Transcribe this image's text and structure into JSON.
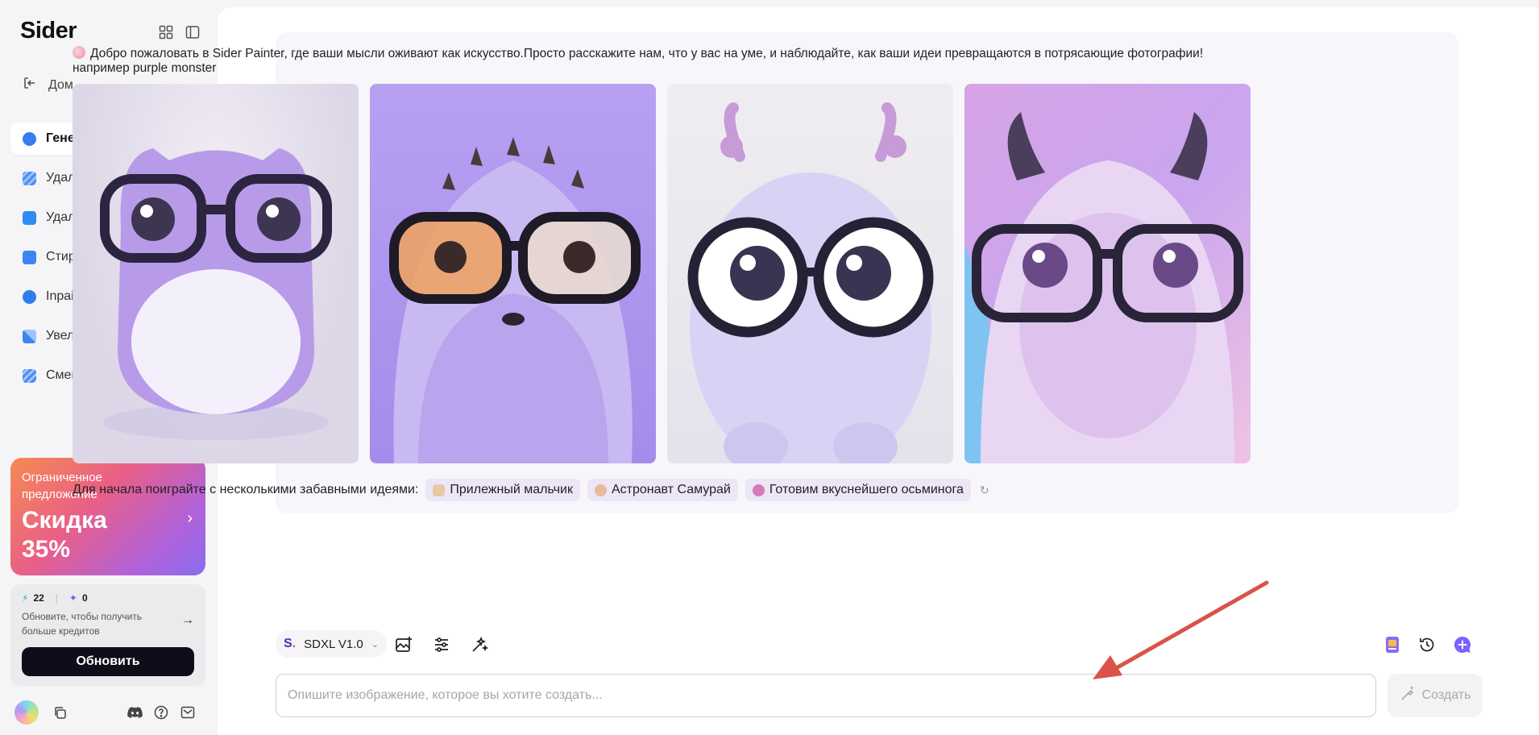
{
  "app": {
    "name": "Sider"
  },
  "sidebar": {
    "home_label": "Дом",
    "items": [
      {
        "label": "Генератор изображе...",
        "icon": "image-generator-icon",
        "color": "#3a7bf0",
        "active": true
      },
      {
        "label": "Удаление фона",
        "icon": "background-remove-icon",
        "color": "#4b8ef5",
        "active": false
      },
      {
        "label": "Удаление текста",
        "icon": "text-remove-icon",
        "color": "#2f8cf0",
        "active": false
      },
      {
        "label": "Стирание Фото",
        "icon": "photo-erase-icon",
        "color": "#3b86f2",
        "active": false
      },
      {
        "label": "Inpaint",
        "icon": "inpaint-icon",
        "color": "#2f7de8",
        "active": false
      },
      {
        "label": "Увеличитель изображ...",
        "icon": "upscale-icon",
        "color": "#3a85f0",
        "active": false
      },
      {
        "label": "Сменщик фона",
        "icon": "background-change-icon",
        "color": "#4a8cf0",
        "active": false
      }
    ],
    "promo": {
      "line1": "Ограниченное предложение",
      "title": "Скидка 35%"
    },
    "credits": {
      "fast": "22",
      "advanced": "0",
      "note": "Обновите, чтобы получить больше кредитов",
      "upgrade_label": "Обновить"
    }
  },
  "main": {
    "welcome": "Добро пожаловать в Sider Painter, где ваши мысли оживают как искусство.Просто расскажите нам, что у вас на уме, и наблюдайте, как ваши идеи превращаются в потрясающие фотографии!",
    "example": "например purple monster",
    "ideas_label": "Для начала поиграйте с несколькими забавными идеями:",
    "ideas": [
      {
        "label": "Прилежный мальчик",
        "color": "#e9c9a3"
      },
      {
        "label": "Астронавт Самурай",
        "color": "#e8b89a"
      },
      {
        "label": "Готовим вкуснейшего осьминога",
        "color": "#d879b8"
      }
    ],
    "model": "SDXL V1.0",
    "prompt_placeholder": "Опишите изображение, которое вы хотите создать...",
    "create_label": "Создать"
  },
  "colors": {
    "accent": "#7b61ff",
    "promo_gradient": [
      "#f58b52",
      "#ea5f86",
      "#b262d8",
      "#8a6cf0"
    ],
    "annotation_arrow": "#d9534a"
  }
}
